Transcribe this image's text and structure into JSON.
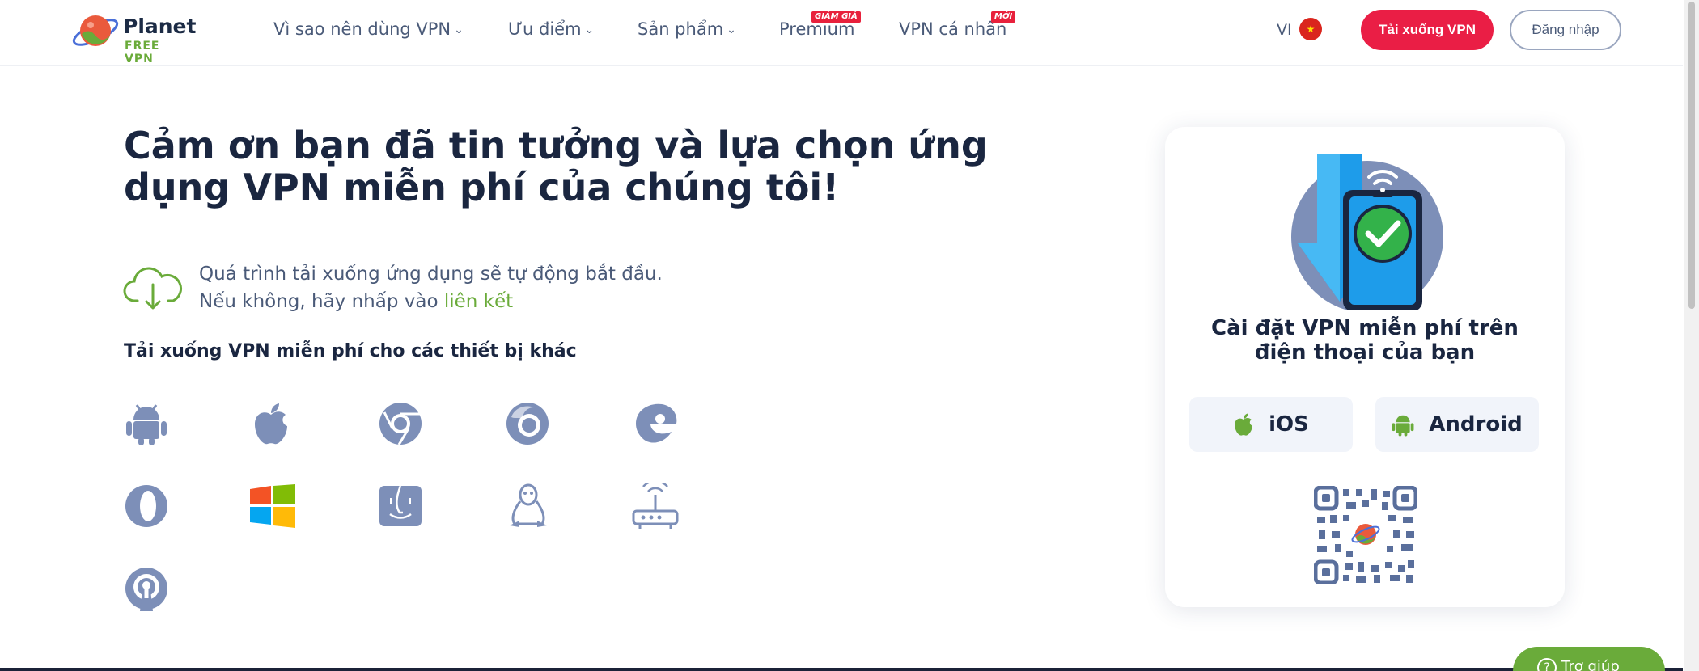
{
  "header": {
    "logo_line1": "Planet",
    "logo_line2": "FREE VPN",
    "nav": [
      {
        "label": "Vì sao nên dùng VPN",
        "has_dropdown": true
      },
      {
        "label": "Ưu điểm",
        "has_dropdown": true
      },
      {
        "label": "Sản phẩm",
        "has_dropdown": true
      },
      {
        "label": "Premium",
        "badge": "GIẢM GIÁ"
      },
      {
        "label": "VPN cá nhân",
        "badge": "MỚI"
      }
    ],
    "chevron": "⌄",
    "language": "VI",
    "flag_star": "★",
    "download_button": "Tải xuống VPN",
    "login_button": "Đăng nhập"
  },
  "main": {
    "headline": "Cảm ơn bạn đã tin tưởng và lựa chọn ứng dụng VPN miễn phí của chúng tôi!",
    "notice_line1": "Quá trình tải xuống ứng dụng sẽ tự động bắt đầu.",
    "notice_line2_prefix": "Nếu không, hãy nhấp vào ",
    "notice_link": "liên kết",
    "subheading": "Tải xuống VPN miễn phí cho các thiết bị khác",
    "platform_icons": [
      "android-icon",
      "apple-icon",
      "chrome-icon",
      "firefox-icon",
      "edge-icon",
      "opera-icon",
      "windows-icon",
      "finder-icon",
      "linux-icon",
      "router-icon",
      "openvpn-icon"
    ]
  },
  "card": {
    "title_line1": "Cài đặt VPN miễn phí trên",
    "title_line2": "điện thoại của bạn",
    "ios_label": "iOS",
    "android_label": "Android"
  },
  "help": {
    "label": "Trợ giúp",
    "q": "?"
  },
  "colors": {
    "accent_red": "#ea1e45",
    "accent_green": "#6aab3a",
    "icon_blue": "#7d8fb8",
    "text_dark": "#1a2640"
  }
}
